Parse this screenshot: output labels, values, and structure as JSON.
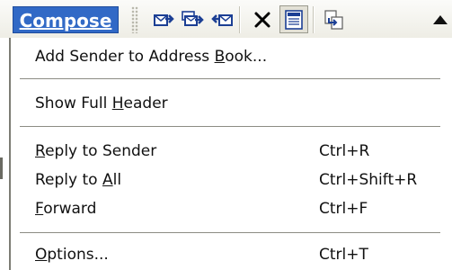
{
  "toolbar": {
    "menu_button_label": "Compose",
    "icons": [
      "reply-to-sender-icon",
      "reply-to-all-icon",
      "forward-icon",
      "delete-icon",
      "full-header-icon",
      "move-message-icon",
      "previous-message-icon"
    ]
  },
  "menu": {
    "items": [
      {
        "pre": "Add Sender to Address ",
        "acc": "B",
        "post": "ook...",
        "shortcut": ""
      },
      {
        "pre": "Show Full ",
        "acc": "H",
        "post": "eader",
        "shortcut": ""
      },
      {
        "pre": "",
        "acc": "R",
        "post": "eply to Sender",
        "shortcut": "Ctrl+R"
      },
      {
        "pre": "Reply to ",
        "acc": "A",
        "post": "ll",
        "shortcut": "Ctrl+Shift+R"
      },
      {
        "pre": "",
        "acc": "F",
        "post": "orward",
        "shortcut": "Ctrl+F"
      },
      {
        "pre": "",
        "acc": "O",
        "post": "ptions...",
        "shortcut": "Ctrl+T"
      }
    ]
  },
  "colors": {
    "menu_button_bg": "#3169c6",
    "toolbar_bg": "#eeede5",
    "icon_blue": "#1c3f94"
  }
}
